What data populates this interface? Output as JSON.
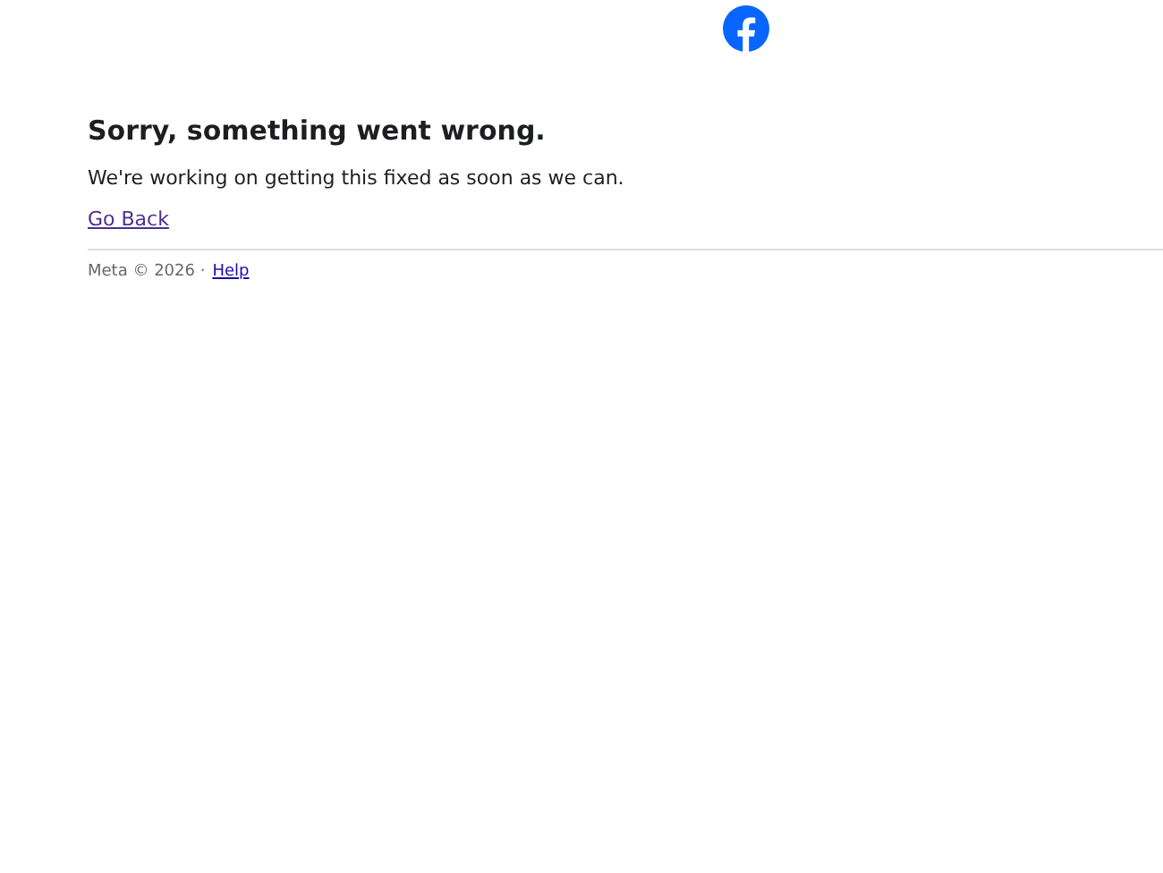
{
  "header": {
    "logo": {
      "kind": "logo"
    }
  },
  "error": {
    "title": "Sorry, something went wrong.",
    "message": "We're working on getting this fixed as soon as we can.",
    "link": "Go Back"
  },
  "footer": {
    "copyright": "Meta © 2026 ·",
    "help_link": "Help"
  }
}
